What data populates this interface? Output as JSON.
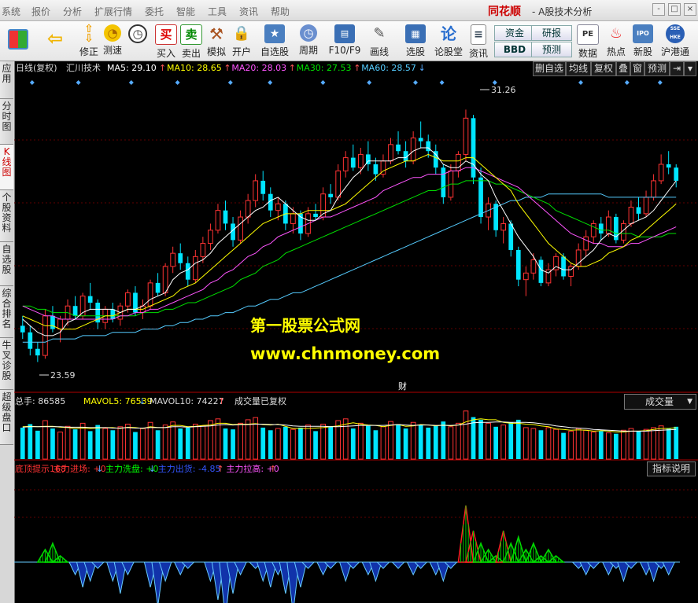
{
  "menu": [
    "系统",
    "报价",
    "分析",
    "扩展行情",
    "委托",
    "智能",
    "工具",
    "资讯",
    "帮助"
  ],
  "brand": "同花顺",
  "app_title": "- A股技术分析",
  "window_controls": [
    "-",
    "□",
    "×"
  ],
  "toolbar": {
    "items": [
      {
        "label": "",
        "icon": "grid-icon"
      },
      {
        "label": "",
        "icon": "back-arrow-icon"
      },
      {
        "label": "修正",
        "icon": "up-down-arrow-icon"
      },
      {
        "label": "测速",
        "icon": "speed-icon"
      },
      {
        "label": "",
        "icon": "clock-icon"
      },
      {
        "label": "买入",
        "icon": "buy-icon",
        "glyph": "买"
      },
      {
        "label": "卖出",
        "icon": "sell-icon",
        "glyph": "卖"
      },
      {
        "label": "模拟",
        "icon": "hammer-icon"
      },
      {
        "label": "开户",
        "icon": "lock-icon"
      },
      {
        "label": "自选股",
        "icon": "star-icon"
      },
      {
        "label": "周期",
        "icon": "clock-cycle-icon"
      },
      {
        "label": "F10/F9",
        "icon": "f10-icon"
      },
      {
        "label": "画线",
        "icon": "pen-icon"
      },
      {
        "label": "选股",
        "icon": "stock-pick-icon"
      },
      {
        "label": "论股堂",
        "icon": "lun-icon",
        "glyph": "论"
      },
      {
        "label": "资讯",
        "icon": "news-icon"
      },
      {
        "label": "数据",
        "icon": "pe-icon",
        "glyph": "PE"
      },
      {
        "label": "热点",
        "icon": "hot-icon"
      },
      {
        "label": "新股",
        "icon": "ipo-icon",
        "glyph": "IPO"
      },
      {
        "label": "沪港通",
        "icon": "sse-hke-icon",
        "glyph": "SSE HKE"
      }
    ],
    "small_buttons": [
      "资金",
      "BBD",
      "研报",
      "预测"
    ]
  },
  "sidebar": {
    "tabs": [
      "应用",
      "分时图",
      "K线图",
      "个股资料",
      "自选股",
      "综合排名",
      "牛叉诊股",
      "超级盘口"
    ],
    "active": "K线图"
  },
  "price_header": {
    "period": "日线(复权)",
    "stock": "汇川技术",
    "ma": [
      {
        "label": "MA5: 29.10",
        "arrow": "↑",
        "color": "#ffffff"
      },
      {
        "label": "MA10: 28.65",
        "arrow": "↑",
        "color": "#ffff00"
      },
      {
        "label": "MA20: 28.03",
        "arrow": "↑",
        "color": "#ff55ff"
      },
      {
        "label": "MA30: 27.53",
        "arrow": "↑",
        "color": "#00e000"
      },
      {
        "label": "MA60: 28.57",
        "arrow": "↓",
        "color": "#55ccff"
      }
    ]
  },
  "right_buttons": [
    "删自选",
    "均线",
    "复权",
    "叠",
    "窗",
    "预测"
  ],
  "price_panel": {
    "high_label": "31.26",
    "low_label": "23.59",
    "cai_label": "财",
    "watermark_title": "第一股票公式网",
    "watermark_url": "www.chnmoney.com"
  },
  "volume_header": {
    "total": "总手: 86585",
    "mavol5": "MAVOL5: 76539",
    "mavol5_arrow": "↓",
    "mavol10": "MAVOL10: 74227",
    "mavol10_arrow": "↑",
    "note": "成交量已复权",
    "dropdown": "成交量"
  },
  "indicator_header": {
    "items": [
      {
        "label": "底顶提示168",
        "color": "#ff3333"
      },
      {
        "label": "主力进场: +0",
        "arrow": "↓",
        "color": "#ff3333"
      },
      {
        "label": "主力洗盘: +0",
        "arrow": "↓",
        "color": "#00ff00"
      },
      {
        "label": "主力出货: -4.85",
        "arrow": "↑",
        "color": "#3355ff"
      },
      {
        "label": "主力拉高: +0",
        "arrow": "↑",
        "color": "#ff55ff"
      }
    ],
    "explain_button": "指标说明"
  },
  "chart_data": {
    "type": "candlestick",
    "title": "",
    "ylim": [
      22.8,
      32.2
    ],
    "high": 31.26,
    "low": 23.59,
    "colors": {
      "up": "#ff3333",
      "down": "#00e5ff",
      "ma5": "#ffffff",
      "ma10": "#ffff00",
      "ma20": "#ff55ff",
      "ma30": "#00e000",
      "ma60": "#55ccff"
    },
    "ohlc": [
      [
        24.7,
        25.0,
        24.3,
        24.5
      ],
      [
        24.5,
        24.7,
        23.8,
        24.0
      ],
      [
        24.0,
        24.2,
        23.6,
        23.8
      ],
      [
        23.8,
        25.2,
        23.7,
        25.0
      ],
      [
        25.0,
        25.3,
        24.5,
        24.6
      ],
      [
        24.6,
        25.0,
        24.2,
        24.9
      ],
      [
        24.9,
        25.5,
        24.7,
        25.3
      ],
      [
        25.3,
        25.6,
        24.9,
        25.0
      ],
      [
        25.0,
        25.7,
        24.9,
        25.6
      ],
      [
        25.6,
        26.0,
        25.2,
        25.4
      ],
      [
        25.4,
        25.5,
        24.6,
        24.8
      ],
      [
        24.8,
        25.3,
        24.6,
        25.2
      ],
      [
        25.2,
        25.4,
        24.8,
        24.9
      ],
      [
        24.9,
        25.4,
        24.7,
        25.3
      ],
      [
        25.3,
        25.8,
        25.1,
        25.7
      ],
      [
        25.7,
        25.9,
        25.0,
        25.1
      ],
      [
        25.1,
        25.5,
        24.9,
        25.3
      ],
      [
        25.3,
        26.1,
        25.2,
        26.0
      ],
      [
        26.0,
        26.3,
        25.6,
        25.7
      ],
      [
        25.7,
        26.6,
        25.6,
        26.5
      ],
      [
        26.5,
        27.1,
        26.3,
        26.9
      ],
      [
        26.9,
        27.2,
        26.4,
        26.6
      ],
      [
        26.6,
        26.8,
        25.9,
        26.1
      ],
      [
        26.1,
        27.0,
        26.0,
        26.8
      ],
      [
        26.8,
        27.4,
        26.6,
        27.2
      ],
      [
        27.2,
        27.8,
        27.0,
        27.6
      ],
      [
        27.6,
        28.4,
        27.5,
        28.2
      ],
      [
        28.2,
        28.5,
        27.6,
        27.8
      ],
      [
        27.8,
        28.0,
        27.1,
        27.3
      ],
      [
        27.3,
        28.2,
        27.2,
        28.0
      ],
      [
        28.0,
        28.7,
        27.8,
        28.5
      ],
      [
        28.5,
        29.3,
        28.3,
        29.1
      ],
      [
        29.1,
        29.4,
        28.5,
        28.7
      ],
      [
        28.7,
        28.9,
        28.0,
        28.2
      ],
      [
        28.2,
        28.6,
        27.9,
        28.4
      ],
      [
        28.4,
        28.5,
        27.6,
        27.8
      ],
      [
        27.8,
        28.3,
        27.5,
        28.1
      ],
      [
        28.1,
        28.2,
        27.3,
        27.5
      ],
      [
        27.5,
        28.3,
        27.4,
        28.1
      ],
      [
        28.1,
        28.4,
        27.9,
        28.0
      ],
      [
        28.0,
        28.9,
        27.9,
        28.7
      ],
      [
        28.7,
        29.0,
        28.4,
        28.6
      ],
      [
        28.6,
        29.6,
        28.5,
        29.4
      ],
      [
        29.4,
        30.0,
        29.2,
        29.8
      ],
      [
        29.8,
        30.2,
        29.4,
        29.5
      ],
      [
        29.5,
        30.1,
        29.3,
        29.9
      ],
      [
        29.9,
        30.3,
        29.4,
        29.6
      ],
      [
        29.6,
        29.8,
        29.1,
        29.3
      ],
      [
        29.3,
        29.9,
        29.2,
        29.7
      ],
      [
        29.7,
        30.4,
        29.6,
        30.2
      ],
      [
        30.2,
        30.6,
        29.9,
        30.0
      ],
      [
        30.0,
        30.3,
        29.5,
        29.7
      ],
      [
        29.7,
        30.6,
        29.6,
        30.4
      ],
      [
        30.4,
        30.9,
        30.1,
        30.3
      ],
      [
        30.3,
        30.5,
        29.8,
        30.0
      ],
      [
        30.0,
        30.2,
        29.3,
        29.5
      ],
      [
        29.5,
        29.6,
        28.4,
        28.6
      ],
      [
        28.6,
        29.6,
        28.5,
        29.4
      ],
      [
        29.4,
        30.0,
        29.2,
        29.9
      ],
      [
        29.9,
        31.26,
        29.7,
        31.0
      ],
      [
        31.0,
        31.1,
        29.0,
        29.2
      ],
      [
        29.2,
        29.5,
        27.8,
        28.0
      ],
      [
        28.0,
        28.6,
        27.6,
        28.4
      ],
      [
        28.4,
        28.5,
        27.4,
        27.6
      ],
      [
        27.6,
        28.0,
        27.2,
        27.8
      ],
      [
        27.8,
        27.9,
        26.8,
        27.0
      ],
      [
        27.0,
        27.1,
        25.9,
        26.1
      ],
      [
        26.1,
        26.5,
        25.6,
        26.3
      ],
      [
        26.3,
        26.9,
        26.1,
        26.7
      ],
      [
        26.7,
        26.8,
        25.9,
        26.0
      ],
      [
        26.0,
        26.6,
        25.9,
        26.4
      ],
      [
        26.4,
        26.9,
        26.2,
        26.8
      ],
      [
        26.8,
        26.9,
        26.1,
        26.2
      ],
      [
        26.2,
        26.6,
        25.9,
        26.5
      ],
      [
        26.5,
        27.2,
        26.4,
        27.0
      ],
      [
        27.0,
        27.6,
        26.8,
        27.4
      ],
      [
        27.4,
        27.9,
        27.2,
        27.8
      ],
      [
        27.8,
        28.0,
        27.3,
        27.5
      ],
      [
        27.5,
        28.2,
        27.4,
        28.0
      ],
      [
        28.0,
        28.1,
        27.2,
        27.3
      ],
      [
        27.3,
        27.9,
        27.2,
        27.8
      ],
      [
        27.8,
        28.5,
        27.7,
        28.3
      ],
      [
        28.3,
        28.6,
        27.9,
        28.1
      ],
      [
        28.1,
        28.8,
        28.0,
        28.6
      ],
      [
        28.6,
        29.3,
        28.5,
        29.1
      ],
      [
        29.1,
        29.9,
        29.0,
        29.6
      ],
      [
        29.6,
        30.0,
        29.3,
        29.5
      ],
      [
        29.5,
        29.6,
        28.9,
        29.1
      ]
    ],
    "ma5": [
      24.9,
      24.7,
      24.5,
      24.4,
      24.4,
      24.5,
      24.8,
      24.9,
      25.1,
      25.2,
      25.2,
      25.2,
      25.2,
      25.1,
      25.2,
      25.2,
      25.3,
      25.5,
      25.6,
      25.7,
      26.1,
      26.3,
      26.4,
      26.6,
      26.7,
      26.9,
      27.2,
      27.4,
      27.6,
      27.8,
      28.0,
      28.2,
      28.3,
      28.5,
      28.6,
      28.4,
      28.2,
      28.0,
      27.9,
      27.9,
      28.1,
      28.2,
      28.6,
      28.9,
      29.2,
      29.4,
      29.7,
      29.7,
      29.7,
      29.7,
      29.8,
      29.8,
      30.0,
      30.1,
      30.1,
      29.9,
      29.6,
      29.5,
      29.5,
      29.7,
      29.6,
      29.3,
      29.1,
      28.6,
      28.2,
      27.8,
      27.4,
      27.1,
      26.8,
      26.4,
      26.3,
      26.5,
      26.4,
      26.4,
      26.6,
      26.8,
      27.0,
      27.3,
      27.5,
      27.4,
      27.6,
      27.8,
      27.9,
      28.0,
      28.2,
      28.5,
      28.8,
      29.1
    ],
    "ma10": [
      25.0,
      24.9,
      24.8,
      24.7,
      24.7,
      24.6,
      24.6,
      24.6,
      24.7,
      24.8,
      24.9,
      25.0,
      25.0,
      25.1,
      25.2,
      25.2,
      25.2,
      25.3,
      25.4,
      25.5,
      25.6,
      25.8,
      25.9,
      26.0,
      26.2,
      26.4,
      26.6,
      26.8,
      27.0,
      27.2,
      27.4,
      27.6,
      27.8,
      27.9,
      28.0,
      28.1,
      28.1,
      28.1,
      28.2,
      28.2,
      28.2,
      28.2,
      28.3,
      28.4,
      28.6,
      28.8,
      29.0,
      29.2,
      29.4,
      29.5,
      29.6,
      29.7,
      29.7,
      29.8,
      29.9,
      29.8,
      29.7,
      29.7,
      29.7,
      29.8,
      29.8,
      29.6,
      29.4,
      29.2,
      29.0,
      28.8,
      28.4,
      28.1,
      27.8,
      27.5,
      27.2,
      27.0,
      26.8,
      26.6,
      26.5,
      26.5,
      26.6,
      26.7,
      26.9,
      27.0,
      27.1,
      27.3,
      27.4,
      27.6,
      27.8,
      28.0,
      28.2,
      28.4
    ],
    "ma20": [
      25.3,
      25.2,
      25.1,
      25.0,
      25.0,
      24.9,
      24.9,
      24.9,
      24.9,
      24.9,
      24.9,
      24.9,
      24.9,
      25.0,
      25.0,
      25.1,
      25.1,
      25.2,
      25.2,
      25.3,
      25.4,
      25.5,
      25.6,
      25.7,
      25.8,
      26.0,
      26.1,
      26.3,
      26.4,
      26.6,
      26.8,
      26.9,
      27.1,
      27.2,
      27.4,
      27.5,
      27.6,
      27.7,
      27.8,
      27.9,
      28.0,
      28.0,
      28.1,
      28.2,
      28.3,
      28.4,
      28.5,
      28.6,
      28.8,
      28.9,
      29.0,
      29.1,
      29.2,
      29.2,
      29.3,
      29.3,
      29.3,
      29.4,
      29.4,
      29.5,
      29.5,
      29.4,
      29.3,
      29.2,
      29.1,
      29.0,
      28.9,
      28.7,
      28.5,
      28.3,
      28.1,
      27.9,
      27.7,
      27.5,
      27.4,
      27.3,
      27.2,
      27.2,
      27.1,
      27.1,
      27.1,
      27.2,
      27.2,
      27.3,
      27.4,
      27.5,
      27.6,
      27.7
    ],
    "ma30": [
      25.3,
      25.3,
      25.2,
      25.2,
      25.1,
      25.1,
      25.1,
      25.0,
      25.0,
      25.0,
      25.0,
      25.0,
      25.0,
      25.0,
      25.0,
      25.0,
      25.1,
      25.1,
      25.1,
      25.2,
      25.2,
      25.3,
      25.4,
      25.4,
      25.5,
      25.6,
      25.7,
      25.8,
      25.9,
      26.1,
      26.2,
      26.3,
      26.5,
      26.6,
      26.7,
      26.9,
      27.0,
      27.1,
      27.2,
      27.3,
      27.4,
      27.5,
      27.6,
      27.7,
      27.8,
      27.9,
      28.0,
      28.1,
      28.2,
      28.3,
      28.4,
      28.5,
      28.6,
      28.7,
      28.8,
      28.8,
      28.9,
      29.0,
      29.0,
      29.1,
      29.1,
      29.1,
      29.1,
      29.0,
      29.0,
      28.9,
      28.8,
      28.7,
      28.6,
      28.5,
      28.4,
      28.2,
      28.1,
      28.0,
      27.9,
      27.8,
      27.7,
      27.6,
      27.6,
      27.5,
      27.5,
      27.5,
      27.4,
      27.4,
      27.4,
      27.4,
      27.5,
      27.5
    ],
    "ma60": [
      24.2,
      24.2,
      24.2,
      24.2,
      24.3,
      24.3,
      24.3,
      24.3,
      24.4,
      24.4,
      24.4,
      24.4,
      24.5,
      24.5,
      24.5,
      24.5,
      24.6,
      24.6,
      24.6,
      24.7,
      24.7,
      24.8,
      24.8,
      24.9,
      24.9,
      25.0,
      25.0,
      25.1,
      25.1,
      25.2,
      25.3,
      25.3,
      25.4,
      25.5,
      25.5,
      25.6,
      25.7,
      25.7,
      25.8,
      25.9,
      26.0,
      26.1,
      26.2,
      26.3,
      26.4,
      26.5,
      26.6,
      26.7,
      26.8,
      26.9,
      27.0,
      27.1,
      27.2,
      27.3,
      27.4,
      27.5,
      27.6,
      27.7,
      27.8,
      27.9,
      28.0,
      28.1,
      28.2,
      28.3,
      28.4,
      28.5,
      28.5,
      28.6,
      28.6,
      28.6,
      28.7,
      28.7,
      28.7,
      28.7,
      28.7,
      28.7,
      28.7,
      28.7,
      28.6,
      28.6,
      28.6,
      28.6,
      28.6,
      28.6,
      28.6,
      28.6,
      28.6,
      28.6
    ],
    "volume": [
      72,
      80,
      65,
      88,
      70,
      62,
      75,
      68,
      82,
      64,
      78,
      70,
      66,
      74,
      80,
      62,
      70,
      84,
      66,
      78,
      85,
      70,
      72,
      80,
      76,
      88,
      92,
      70,
      68,
      82,
      90,
      95,
      72,
      66,
      70,
      74,
      68,
      72,
      78,
      64,
      80,
      75,
      88,
      92,
      70,
      82,
      76,
      66,
      74,
      86,
      80,
      70,
      84,
      78,
      72,
      76,
      86,
      74,
      82,
      110,
      96,
      90,
      82,
      74,
      78,
      84,
      90,
      72,
      70,
      66,
      72,
      68,
      60,
      64,
      70,
      66,
      62,
      64,
      60,
      58,
      66,
      70,
      64,
      68,
      72,
      76,
      70,
      74
    ],
    "mavol5": [
      74,
      75,
      74,
      75,
      75,
      73,
      72,
      70,
      71,
      70,
      71,
      72,
      72,
      70,
      73,
      72,
      70,
      74,
      72,
      72,
      77,
      77,
      74,
      75,
      77,
      78,
      82,
      82,
      79,
      80,
      80,
      81,
      79,
      78,
      80,
      75,
      70,
      70,
      70,
      71,
      72,
      74,
      76,
      80,
      83,
      80,
      78,
      77,
      74,
      77,
      79,
      75,
      76,
      79,
      78,
      76,
      78,
      76,
      78,
      85,
      90,
      92,
      90,
      90,
      84,
      82,
      82,
      80,
      79,
      76,
      74,
      69,
      68,
      66,
      67,
      66,
      64,
      65,
      64,
      62,
      62,
      64,
      64,
      65,
      68,
      70,
      70,
      72
    ],
    "mavol10": [
      73,
      74,
      74,
      74,
      74,
      74,
      73,
      73,
      73,
      72,
      72,
      72,
      71,
      71,
      72,
      71,
      71,
      72,
      72,
      72,
      74,
      74,
      73,
      74,
      75,
      76,
      78,
      79,
      78,
      79,
      79,
      80,
      80,
      79,
      79,
      78,
      76,
      75,
      75,
      75,
      75,
      74,
      74,
      75,
      76,
      77,
      77,
      77,
      77,
      78,
      79,
      78,
      77,
      78,
      78,
      77,
      77,
      77,
      78,
      80,
      83,
      84,
      84,
      85,
      85,
      84,
      84,
      84,
      83,
      81,
      79,
      76,
      74,
      72,
      71,
      70,
      68,
      67,
      66,
      65,
      64,
      64,
      64,
      64,
      65,
      66,
      67,
      68
    ],
    "indicator": [
      0,
      0,
      0,
      2,
      3,
      1,
      0,
      -2,
      -4,
      -3,
      -1,
      0,
      -3,
      -5,
      -2,
      0,
      0,
      -4,
      -7,
      -3,
      0,
      -2,
      -1,
      0,
      0,
      -3,
      -6,
      -9,
      -5,
      -2,
      0,
      -1,
      -3,
      -4,
      -2,
      -5,
      -8,
      -4,
      -1,
      0,
      -2,
      -1,
      0,
      -3,
      -1,
      0,
      -2,
      -3,
      -1,
      0,
      -1,
      0,
      -2,
      -1,
      0,
      -2,
      -3,
      -1,
      0,
      9,
      5,
      3,
      2,
      1,
      5,
      3,
      4,
      2,
      3,
      1,
      2,
      1,
      0,
      0,
      -1,
      -2,
      -1,
      0,
      -2,
      -1,
      -3,
      -1,
      0,
      -2,
      -3,
      -1,
      -2,
      0
    ]
  }
}
